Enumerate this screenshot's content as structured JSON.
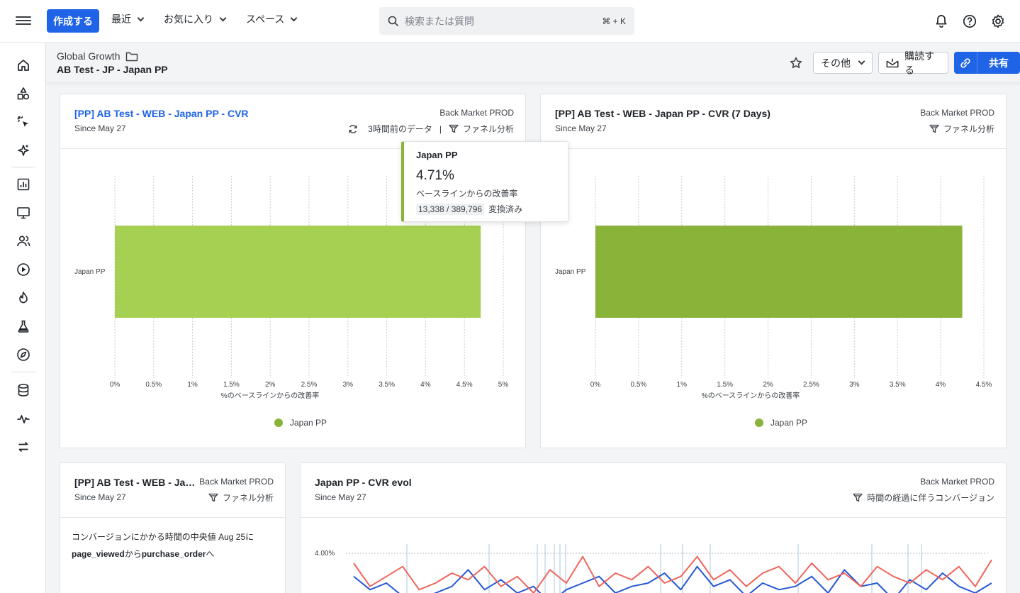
{
  "topbar": {
    "create_label": "作成する",
    "nav": [
      {
        "label": "最近"
      },
      {
        "label": "お気に入り"
      },
      {
        "label": "スペース"
      }
    ],
    "search_placeholder": "検索または質問",
    "search_shortcut": "⌘ + K"
  },
  "header": {
    "breadcrumb": "Global Growth",
    "title": "AB Test - JP - Japan PP",
    "more_label": "その他",
    "subscribe_label": "購読する",
    "share_label": "共有"
  },
  "colors": {
    "accent": "#1f63e6",
    "bar_light": "#a6d052",
    "bar_dark": "#8ab33a",
    "series_blue": "#2456d6",
    "series_red": "#f0645a"
  },
  "cards": {
    "c1": {
      "title": "[PP] AB Test - WEB - Japan PP - CVR",
      "since": "Since May 27",
      "source": "Back Market PROD",
      "freshness": "3時間前のデータ",
      "separator": "|",
      "type": "ファネル分析",
      "legend": "Japan PP"
    },
    "c2": {
      "title": "[PP] AB Test - WEB - Japan PP - CVR (7 Days)",
      "since": "Since May 27",
      "source": "Back Market PROD",
      "type": "ファネル分析",
      "legend": "Japan PP"
    },
    "c3": {
      "title": "[PP] AB Test - WEB - Japan PP - CVR",
      "since": "Since May 27",
      "source": "Back Market PROD",
      "type": "ファネル分析",
      "median_prefix": "コンバージョンにかかる時間の中央値 Aug 25に",
      "from_event": "page_viewed",
      "from_word": "から",
      "to_event": "purchase_order",
      "to_word": "へ"
    },
    "c4": {
      "title": "Japan PP - CVR evol",
      "since": "Since May 27",
      "source": "Back Market PROD",
      "type": "時間の経過に伴うコンバージョン"
    }
  },
  "tooltip": {
    "title": "Japan PP",
    "value": "4.71%",
    "label": "ベースラインからの改善率",
    "count": "13,338 / 389,796",
    "count_suffix": "変換済み"
  },
  "chart_data": [
    {
      "type": "bar",
      "orientation": "horizontal",
      "categories": [
        "Japan PP"
      ],
      "values": [
        4.71
      ],
      "xlabel": "%のベースラインからの改善率",
      "ticks": [
        "0%",
        "0.5%",
        "1%",
        "1.5%",
        "2%",
        "2.5%",
        "3%",
        "3.5%",
        "4%",
        "4.5%",
        "5%"
      ],
      "xlim": [
        0,
        5
      ],
      "legend": [
        "Japan PP"
      ],
      "legend_position": "bottom"
    },
    {
      "type": "bar",
      "orientation": "horizontal",
      "categories": [
        "Japan PP"
      ],
      "values": [
        4.25
      ],
      "xlabel": "%のベースラインからの改善率",
      "ticks": [
        "0%",
        "0.5%",
        "1%",
        "1.5%",
        "2%",
        "2.5%",
        "3%",
        "3.5%",
        "4%",
        "4.5%"
      ],
      "xlim": [
        0,
        4.5
      ],
      "legend": [
        "Japan PP"
      ],
      "legend_position": "bottom"
    },
    {
      "type": "line",
      "ytick_visible": "4.00%",
      "series": [
        {
          "values": [
            3.3,
            2.9,
            3.1,
            2.7,
            2.6,
            2.8,
            3.0,
            3.5,
            2.9,
            3.2,
            2.8,
            3.0,
            2.5,
            2.9,
            3.1,
            3.3,
            2.8,
            3.0,
            3.1,
            3.4,
            2.9,
            3.6,
            3.0,
            3.2,
            2.7,
            3.1,
            2.9,
            3.0,
            3.3,
            2.8,
            3.5,
            3.0,
            3.1,
            2.6,
            3.2,
            2.9,
            3.4,
            3.0,
            2.8,
            3.1
          ]
        },
        {
          "values": [
            3.7,
            3.0,
            3.3,
            3.6,
            2.9,
            3.1,
            3.4,
            3.2,
            3.6,
            3.0,
            3.3,
            2.8,
            3.5,
            3.1,
            3.9,
            3.0,
            3.4,
            3.2,
            3.6,
            3.1,
            3.3,
            3.9,
            3.2,
            3.5,
            3.0,
            3.4,
            3.6,
            3.1,
            3.7,
            3.2,
            3.4,
            3.0,
            3.6,
            3.3,
            3.1,
            3.5,
            3.2,
            3.6,
            3.0,
            3.8
          ]
        }
      ]
    }
  ]
}
